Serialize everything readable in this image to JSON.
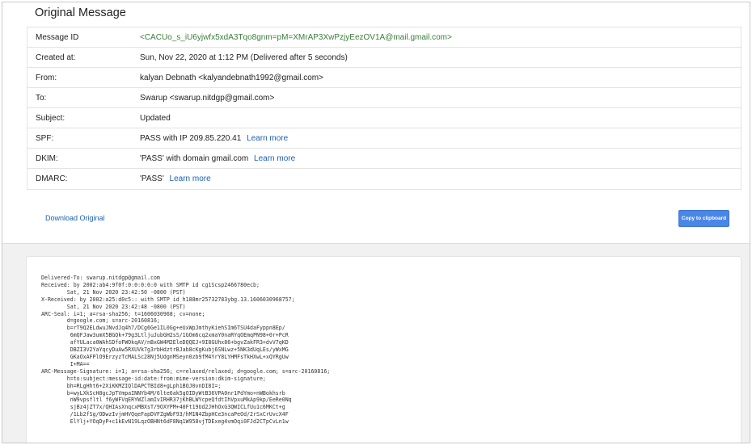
{
  "page_title": "Original Message",
  "meta_rows": [
    {
      "label": "Message ID",
      "value": "<CACUo_s_iU6yjwfx5xdA3Tqo8gnm=pM=XMrAP3XwPzjyEezOV1A@mail.gmail.com>",
      "link": ""
    },
    {
      "label": "Created at:",
      "value": "Sun, Nov 22, 2020 at 1:12 PM (Delivered after 5 seconds)",
      "link": ""
    },
    {
      "label": "From:",
      "value": "kalyan Debnath <kalyandebnath1992@gmail.com>",
      "link": ""
    },
    {
      "label": "To:",
      "value": "Swarup <swarup.nitdgp@gmail.com>",
      "link": ""
    },
    {
      "label": "Subject:",
      "value": "Updated",
      "link": ""
    },
    {
      "label": "SPF:",
      "value": "PASS with IP 209.85.220.41",
      "link": "Learn more"
    },
    {
      "label": "DKIM:",
      "value": "'PASS' with domain gmail.com",
      "link": "Learn more"
    },
    {
      "label": "DMARC:",
      "value": "'PASS'",
      "link": "Learn more"
    }
  ],
  "download_label": "Download Original",
  "copy_label": "Copy to clipboard",
  "colors": {
    "message_id": "#3a7d3a",
    "link": "#1a5fb4",
    "button": "#4a86e8"
  },
  "raw_lines": [
    "Delivered-To: swarup.nitdgp@gmail.com",
    "Received: by 2002:ab4:9f0f:0:0:0:0:0 with SMTP id cg1Scsp2466780ecb;",
    "        Sat, 21 Nov 2020 23:42:50 -0800 (PST)",
    "X-Received: by 2002:a25:d0c5:: with SMTP id h188mr25732783ybg.13.1606030968757;",
    "        Sat, 21 Nov 2020 23:42:48 -0800 (PST)",
    "ARC-Seal: i=1; a=rsa-sha256; t=1606030968; cv=none;",
    "        d=google.com; s=arc-20160816;",
    "        b=rT9Q2ELdwuJNvdJq4h7/DCg6Ge1IL0Gg+eUxWpJmthyKiehSIm6TSU4daFyppn8Ep/",
    "         6mQFJaw3umX5BGQk+79g3LtljuJubGH2sS/1GOm6cq2xmaY0naRYqOEmqPN98+0r+PcR",
    "         afYULaca0WAhSDfoFWOkqAV/nBxGW4M2EleDQQEJ+9I8GUhx86+bgvZakFR3+dvV7qKD",
    "         DBZI3V2YaYqcyDuAw5RXUVk7g3rbHdztrBJab8cKgKubj6SNLwz+5NK3dUqLEs/yWxMG",
    "         GKaOxAFPlO9ErzyzTcMALSc28Nj5UdgnMSeyn0zb9fM4YrY8LYHMFsTkHXwL+xQYRgUw",
    "         I+MA==",
    "ARC-Message-Signature: i=1; a=rsa-sha256; c=relaxed/relaxed; d=google.com; s=arc-20160816;",
    "        h=to:subject:message-id:date:from:mime-version:dkim-signature;",
    "        bh=RLgHht6+2XiKKMZIQlDAPCTBId8+gLph1BQJ0vnDI8I=;",
    "        b=wyLXkScH8gcJpTVmpaINNYb4M/6lte6ak5gOIDyWtB36VPA0nr1PdYmo+nWBokhsrb",
    "         nW9vpsfltl f6yWFVqERYWZlamIvIRHR37jKhBLWYcpeQfdtIhVpxuMkAp9kp/EeRe0Nq",
    "         sjBz4jZT7x/QHIAsXnqcxMBXsT/9OXYPM+40Ft19Ud2JHhOxG3QWICLfUu1c6MKCt+g",
    "         /1Lb2fSg/ODwzIvjmHVQqeFapDVFZgWbF93/hM1N4ZbpHCe3ncaPeOd/2rSxCrUvcX4F",
    "         ElYlj+YOqDyP+c1kEvN19LqzOBHNt6dF8Nq1W958vjTDExeg4vmOqi0FJd2CTpCvLn1w"
  ]
}
